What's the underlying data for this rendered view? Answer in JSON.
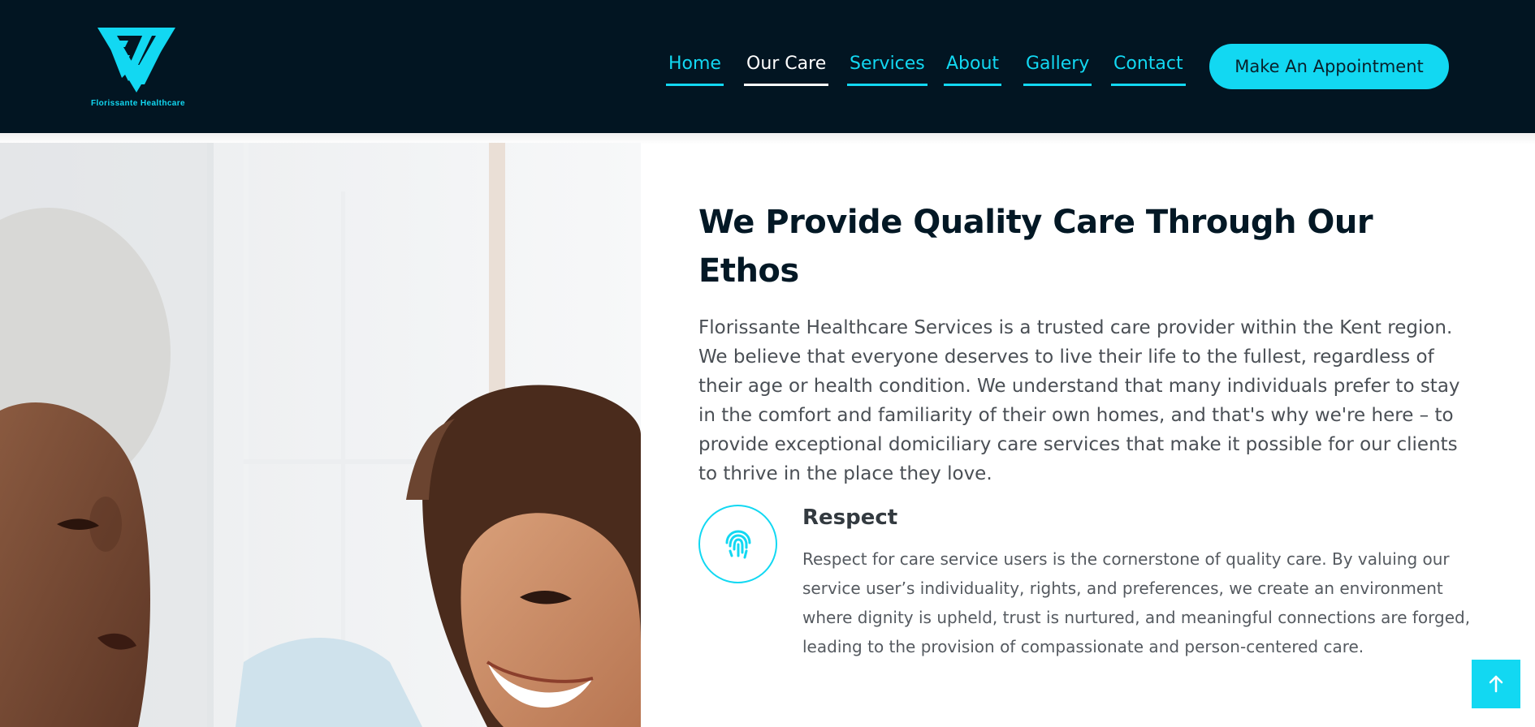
{
  "header": {
    "logo_text": "Florissante Healthcare",
    "nav": [
      {
        "label": "Home",
        "active": false
      },
      {
        "label": "Our Care",
        "active": true
      },
      {
        "label": "Services",
        "active": false
      },
      {
        "label": "About",
        "active": false
      },
      {
        "label": "Gallery",
        "active": false
      },
      {
        "label": "Contact",
        "active": false
      }
    ],
    "cta_label": "Make An Appointment"
  },
  "main": {
    "title": "We Provide Quality Care Through Our Ethos",
    "intro": "Florissante Healthcare Services is a trusted care provider within the Kent region. We believe that everyone deserves to live their life to the fullest, regardless of their age or health condition. We understand that many individuals prefer to stay in the comfort and familiarity of their own homes, and that's why we're here – to provide exceptional domiciliary care services that make it possible for our clients to thrive in the place they love.",
    "feature": {
      "icon": "fingerprint-icon",
      "title": "Respect",
      "text": "Respect for care service users is the cornerstone of quality care. By valuing our service user’s individuality, rights, and preferences, we create an environment where dignity is upheld, trust is nurtured, and meaningful connections are forged, leading to the provision of compassionate and person-centered care."
    }
  },
  "colors": {
    "header_bg": "#021522",
    "accent": "#12d8f2",
    "title": "#031825"
  },
  "icons": {
    "scroll_top": "arrow-up-icon"
  }
}
